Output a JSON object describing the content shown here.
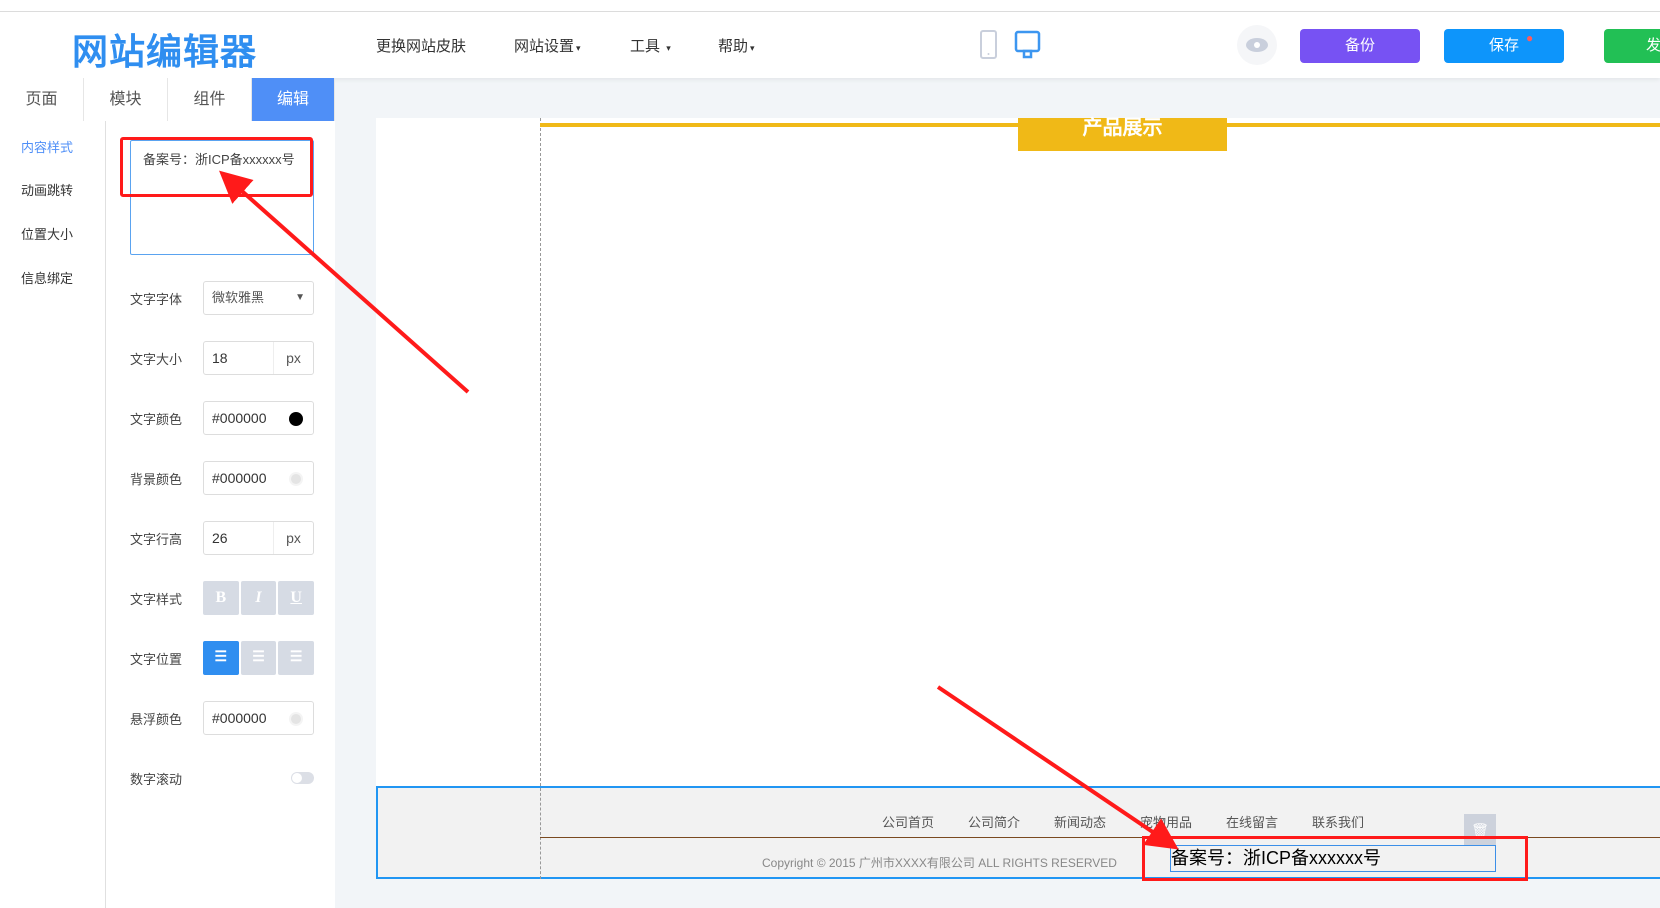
{
  "header": {
    "logo": "网站编辑器",
    "nav": [
      {
        "label": "更换网站皮肤"
      },
      {
        "label": "网站设置",
        "caret": "▾"
      },
      {
        "label": "工具",
        "caret": "▾"
      },
      {
        "label": "帮助",
        "caret": "▾"
      }
    ],
    "backup": "备份",
    "save": "保存",
    "publish": "发"
  },
  "tabs": [
    "页面",
    "模块",
    "组件",
    "编辑"
  ],
  "subnav": [
    "内容样式",
    "动画跳转",
    "位置大小",
    "信息绑定"
  ],
  "form": {
    "content": "备案号：浙ICP备xxxxxx号",
    "font_label": "文字字体",
    "font_value": "微软雅黑",
    "size_label": "文字大小",
    "size_value": "18",
    "unit": "px",
    "color_label": "文字颜色",
    "color_value": "#000000",
    "bg_label": "背景颜色",
    "bg_value": "#000000",
    "lh_label": "文字行高",
    "lh_value": "26",
    "style_label": "文字样式",
    "style_b": "B",
    "style_i": "I",
    "style_u": "U",
    "align_label": "文字位置",
    "hover_label": "悬浮颜色",
    "hover_value": "#000000",
    "scroll_label": "数字滚动"
  },
  "canvas": {
    "section_title": "产品展示",
    "footer_links": [
      "公司首页",
      "公司简介",
      "新闻动态",
      "宠物用品",
      "在线留言",
      "联系我们"
    ],
    "copyright": "Copyright © 2015 广州市XXXX有限公司 ALL RIGHTS RESERVED",
    "icp": "备案号：浙ICP备xxxxxx号"
  },
  "colors": {
    "accent": "#4f8ff7",
    "backup": "#7752f3",
    "save": "#0d95fb",
    "publish": "#22c055",
    "yellow": "#f0b917",
    "annotation": "#ff1a1a"
  }
}
